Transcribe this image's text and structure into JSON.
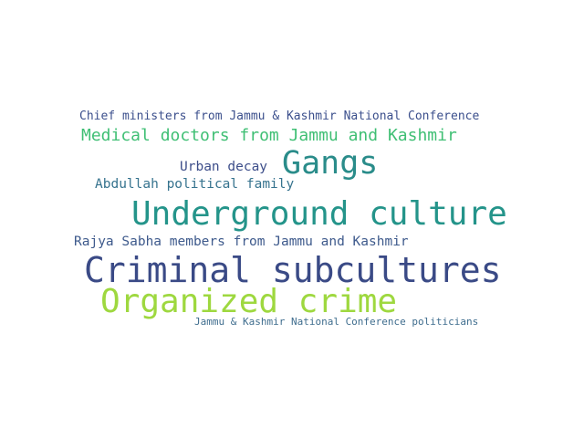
{
  "word_cloud": {
    "words": [
      {
        "text": "Chief ministers from Jammu & Kashmir National Conference",
        "color": "#3b4f8c"
      },
      {
        "text": "Medical doctors from Jammu and Kashmir",
        "color": "#3fbf74"
      },
      {
        "text": "Urban decay",
        "color": "#3d4e8a"
      },
      {
        "text": "Gangs",
        "color": "#2a8c8a"
      },
      {
        "text": "Abdullah political family",
        "color": "#36738e"
      },
      {
        "text": "Underground culture",
        "color": "#24948a"
      },
      {
        "text": "Rajya Sabha members from Jammu and Kashmir",
        "color": "#3e5a8c"
      },
      {
        "text": "Criminal subcultures",
        "color": "#3a4a86"
      },
      {
        "text": "Organized crime",
        "color": "#9ed83f"
      },
      {
        "text": "Jammu & Kashmir National Conference politicians",
        "color": "#3f6d8e"
      }
    ]
  }
}
